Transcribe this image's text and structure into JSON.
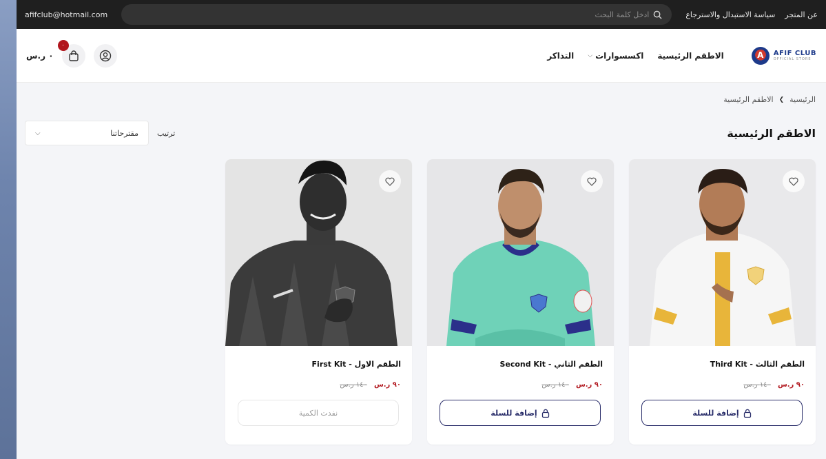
{
  "topbar": {
    "links": [
      "عن المتجر",
      "سياسة الاستبدال والاسترجاع"
    ],
    "search_placeholder": "ادخل كلمة البحث",
    "email": "afifclub@hotmail.com"
  },
  "header": {
    "logo_title": "AFIF CLUB",
    "logo_sub": "OFFICIAL STORE",
    "nav": [
      "الاطقم الرئيسية",
      "اكسسوارات",
      "التذاكر"
    ],
    "cart_count": "٠",
    "cart_total": "٠ ر.س"
  },
  "breadcrumb": [
    "الرئيسية",
    "الاطقم الرئيسية"
  ],
  "page_title": "الاطقم الرئيسية",
  "sort": {
    "label": "ترتيب",
    "value": "مقترحاتنا"
  },
  "products": [
    {
      "name": "الطقم الثالث - Third Kit",
      "price": "٩٠ ر.س",
      "old_price": "١٤٠ ر.س",
      "button": "إضافة للسلة",
      "available": true
    },
    {
      "name": "الطقم الثاني - Second Kit",
      "price": "٩٠ ر.س",
      "old_price": "١٤٠ ر.س",
      "button": "إضافة للسلة",
      "available": true
    },
    {
      "name": "الطقم الاول - First Kit",
      "price": "٩٠ ر.س",
      "old_price": "١٤٠ ر.س",
      "button": "نفدت الكمية",
      "available": false
    }
  ],
  "colors": {
    "brand_navy": "#2b2f6b",
    "price_red": "#b1161d",
    "topbar": "#1f1f1f"
  }
}
